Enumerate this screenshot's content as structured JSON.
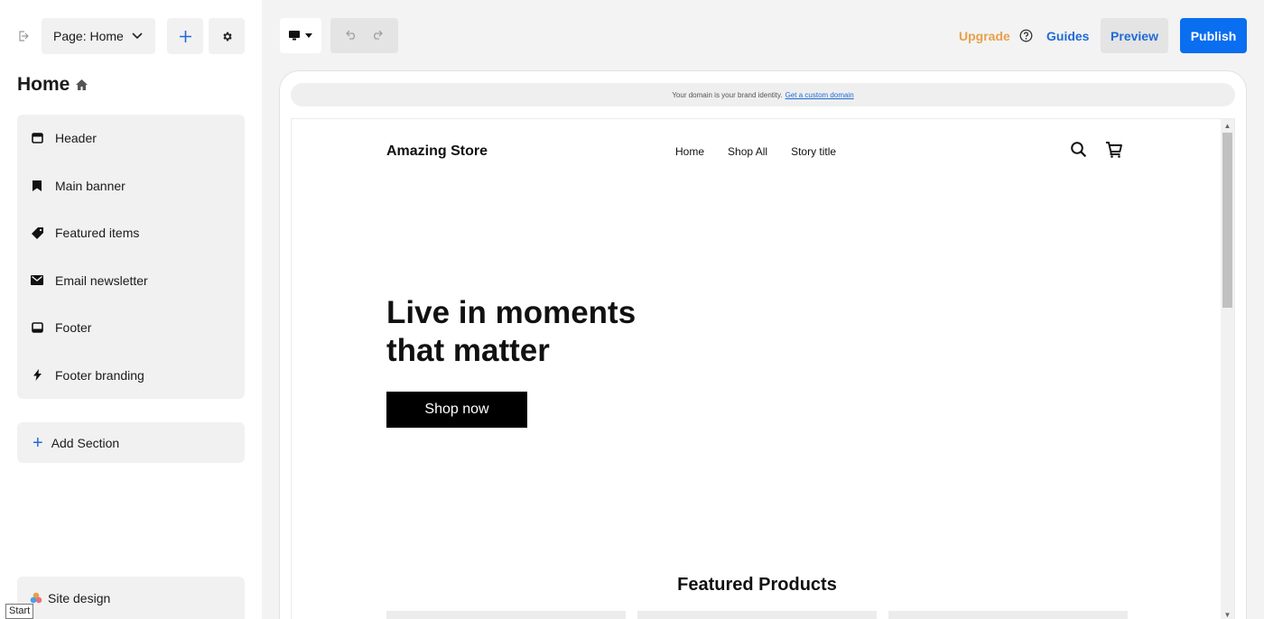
{
  "sidebar": {
    "page_select": "Page: Home",
    "title": "Home",
    "sections": [
      {
        "label": "Header",
        "icon": "header-icon"
      },
      {
        "label": "Main banner",
        "icon": "bookmark-icon"
      },
      {
        "label": "Featured items",
        "icon": "tag-icon"
      },
      {
        "label": "Email newsletter",
        "icon": "envelope-icon"
      },
      {
        "label": "Footer",
        "icon": "footer-icon"
      },
      {
        "label": "Footer branding",
        "icon": "lightning-icon"
      }
    ],
    "add_section": "Add Section",
    "site_design": "Site design",
    "start_tooltip": "Start"
  },
  "topbar": {
    "upgrade": "Upgrade",
    "guides": "Guides",
    "preview": "Preview",
    "publish": "Publish"
  },
  "canvas": {
    "domain_text": "Your domain is your brand identity.",
    "domain_link": "Get a custom domain",
    "store": {
      "logo": "Amazing Store",
      "nav": [
        "Home",
        "Shop All",
        "Story title"
      ],
      "hero_line1": "Live in moments",
      "hero_line2": "that matter",
      "cta": "Shop now",
      "featured_title": "Featured Products"
    }
  },
  "colors": {
    "accent": "#0a6ef0",
    "link": "#1f6bd6",
    "upgrade": "#e8a04a"
  }
}
